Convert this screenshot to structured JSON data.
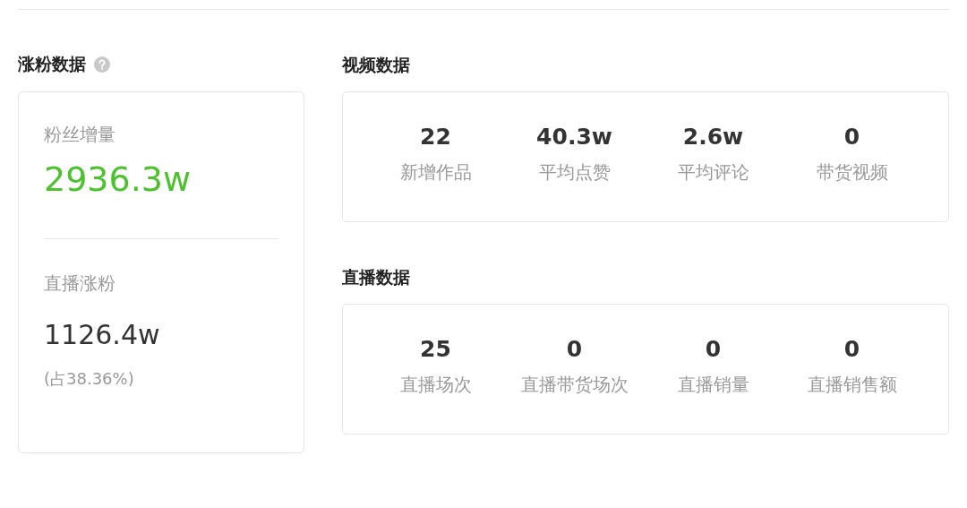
{
  "fans": {
    "title": "涨粉数据",
    "total_label": "粉丝增量",
    "total_value": "2936.3w",
    "live_label": "直播涨粉",
    "live_value": "1126.4w",
    "live_share": "(占38.36%)"
  },
  "sections": [
    {
      "title": "视频数据",
      "stats": [
        {
          "value": "22",
          "label": "新增作品"
        },
        {
          "value": "40.3w",
          "label": "平均点赞"
        },
        {
          "value": "2.6w",
          "label": "平均评论"
        },
        {
          "value": "0",
          "label": "带货视频"
        }
      ]
    },
    {
      "title": "直播数据",
      "stats": [
        {
          "value": "25",
          "label": "直播场次"
        },
        {
          "value": "0",
          "label": "直播带货场次"
        },
        {
          "value": "0",
          "label": "直播销量"
        },
        {
          "value": "0",
          "label": "直播销售额"
        }
      ]
    }
  ]
}
